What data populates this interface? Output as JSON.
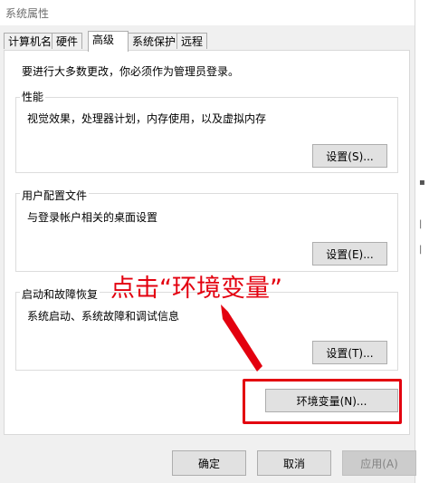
{
  "window": {
    "title": "系统属性"
  },
  "tabs": [
    {
      "label": "计算机名"
    },
    {
      "label": "硬件"
    },
    {
      "label": "高级"
    },
    {
      "label": "系统保护"
    },
    {
      "label": "远程"
    }
  ],
  "active_tab": "高级",
  "notice": "要进行大多数更改，你必须作为管理员登录。",
  "groups": {
    "performance": {
      "title": "性能",
      "desc": "视觉效果，处理器计划，内存使用，以及虚拟内存",
      "button": "设置(S)..."
    },
    "profiles": {
      "title": "用户配置文件",
      "desc": "与登录帐户相关的桌面设置",
      "button": "设置(E)..."
    },
    "startup": {
      "title": "启动和故障恢复",
      "desc": "系统启动、系统故障和调试信息",
      "button": "设置(T)..."
    }
  },
  "env_button": "环境变量(N)...",
  "footer": {
    "ok": "确定",
    "cancel": "取消",
    "apply": "应用(A)"
  },
  "annotation": {
    "text": "点击“环境变量”",
    "color": "#e3000f"
  }
}
